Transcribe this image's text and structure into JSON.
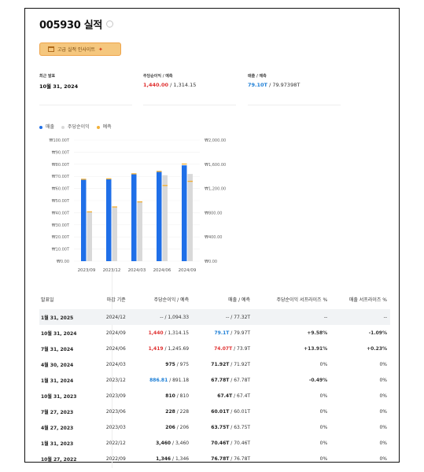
{
  "header": {
    "title": "005930 실적",
    "insight_button": "고급 실적 인사이트"
  },
  "stats": [
    {
      "label": "최근 발표",
      "value": "10월 31, 2024"
    },
    {
      "label": "주당순이익 / 예측",
      "actual": "1,440.00",
      "estimate": " / 1,314.15",
      "actual_color": "red"
    },
    {
      "label": "매출 / 예측",
      "actual": "79.10T",
      "estimate": " / 79.97398T",
      "actual_color": "blue"
    }
  ],
  "legend": [
    "매출",
    "주당순이익",
    "예측"
  ],
  "colors": {
    "revenue": "#1f6fe8",
    "eps": "#d9d9d9",
    "estimate": "#f2b13a",
    "positive": "#e03131",
    "negative": "#1c7ed6"
  },
  "chart_data": {
    "type": "bar",
    "categories": [
      "2023/09",
      "2023/12",
      "2024/03",
      "2024/06",
      "2024/09"
    ],
    "series": [
      {
        "name": "매출",
        "axis": "left",
        "values": [
          67.4,
          67.78,
          71.92,
          74.07,
          79.1
        ]
      },
      {
        "name": "주당순이익",
        "axis": "right",
        "values": [
          810,
          886.81,
          975,
          1419,
          1440
        ]
      },
      {
        "name": "예측",
        "type": "marker",
        "revenue_estimates": [
          67.4,
          67.78,
          71.92,
          73.9,
          79.97
        ],
        "eps_estimates": [
          810,
          891.18,
          975,
          1245.69,
          1314.15
        ]
      }
    ],
    "left_ticks": [
      "₩100.00T",
      "₩90.00T",
      "₩80.00T",
      "₩70.00T",
      "₩60.00T",
      "₩50.00T",
      "₩40.00T",
      "₩30.00T",
      "₩20.00T",
      "₩10.00T",
      "₩0.00"
    ],
    "right_ticks": [
      "₩2,000.00",
      "₩1,600.00",
      "₩1,200.00",
      "₩800.00",
      "₩400.00",
      "₩0.00"
    ],
    "ylim_left": [
      0,
      100
    ],
    "ylim_right": [
      0,
      2000
    ],
    "grid": true,
    "legend_position": "top-left"
  },
  "table": {
    "headers": [
      "발표일",
      "마감 기준",
      "주당순이익 / 예측",
      "매출 / 예측",
      "주당순이익 서프라이즈 %",
      "매출 서프라이즈 %"
    ],
    "rows": [
      {
        "date": "1월 31, 2025",
        "period": "2024/12",
        "eps": "--",
        "eps_est": " / 1,094.33",
        "eps_c": "",
        "rev": "--",
        "rev_est": " / 77.32T",
        "rev_c": "",
        "eps_s": "--",
        "eps_s_c": "",
        "rev_s": "--",
        "rev_s_c": ""
      },
      {
        "date": "10월 31, 2024",
        "period": "2024/09",
        "eps": "1,440",
        "eps_est": " / 1,314.15",
        "eps_c": "red",
        "rev": "79.1T",
        "rev_est": " / 79.97T",
        "rev_c": "blue",
        "eps_s": "+9.58%",
        "eps_s_c": "pos",
        "rev_s": "-1.09%",
        "rev_s_c": "neg"
      },
      {
        "date": "7월 31, 2024",
        "period": "2024/06",
        "eps": "1,419",
        "eps_est": " / 1,245.69",
        "eps_c": "red",
        "rev": "74.07T",
        "rev_est": " / 73.9T",
        "rev_c": "red",
        "eps_s": "+13.91%",
        "eps_s_c": "pos",
        "rev_s": "+0.23%",
        "rev_s_c": "pos"
      },
      {
        "date": "4월 30, 2024",
        "period": "2024/03",
        "eps": "975",
        "eps_est": " / 975",
        "eps_c": "b",
        "rev": "71.92T",
        "rev_est": " / 71.92T",
        "rev_c": "b",
        "eps_s": "0%",
        "eps_s_c": "",
        "rev_s": "0%",
        "rev_s_c": ""
      },
      {
        "date": "1월 31, 2024",
        "period": "2023/12",
        "eps": "886.81",
        "eps_est": " / 891.18",
        "eps_c": "blue",
        "rev": "67.78T",
        "rev_est": " / 67.78T",
        "rev_c": "b",
        "eps_s": "-0.49%",
        "eps_s_c": "neg",
        "rev_s": "0%",
        "rev_s_c": ""
      },
      {
        "date": "10월 31, 2023",
        "period": "2023/09",
        "eps": "810",
        "eps_est": " / 810",
        "eps_c": "b",
        "rev": "67.4T",
        "rev_est": " / 67.4T",
        "rev_c": "b",
        "eps_s": "0%",
        "eps_s_c": "",
        "rev_s": "0%",
        "rev_s_c": ""
      },
      {
        "date": "7월 27, 2023",
        "period": "2023/06",
        "eps": "228",
        "eps_est": " / 228",
        "eps_c": "b",
        "rev": "60.01T",
        "rev_est": " / 60.01T",
        "rev_c": "b",
        "eps_s": "0%",
        "eps_s_c": "",
        "rev_s": "0%",
        "rev_s_c": ""
      },
      {
        "date": "4월 27, 2023",
        "period": "2023/03",
        "eps": "206",
        "eps_est": " / 206",
        "eps_c": "b",
        "rev": "63.75T",
        "rev_est": " / 63.75T",
        "rev_c": "b",
        "eps_s": "0%",
        "eps_s_c": "",
        "rev_s": "0%",
        "rev_s_c": ""
      },
      {
        "date": "1월 31, 2023",
        "period": "2022/12",
        "eps": "3,460",
        "eps_est": " / 3,460",
        "eps_c": "b",
        "rev": "70.46T",
        "rev_est": " / 70.46T",
        "rev_c": "b",
        "eps_s": "0%",
        "eps_s_c": "",
        "rev_s": "0%",
        "rev_s_c": ""
      },
      {
        "date": "10월 27, 2022",
        "period": "2022/09",
        "eps": "1,346",
        "eps_est": " / 1,346",
        "eps_c": "b",
        "rev": "76.78T",
        "rev_est": " / 76.78T",
        "rev_c": "b",
        "eps_s": "0%",
        "eps_s_c": "",
        "rev_s": "0%",
        "rev_s_c": ""
      }
    ]
  }
}
